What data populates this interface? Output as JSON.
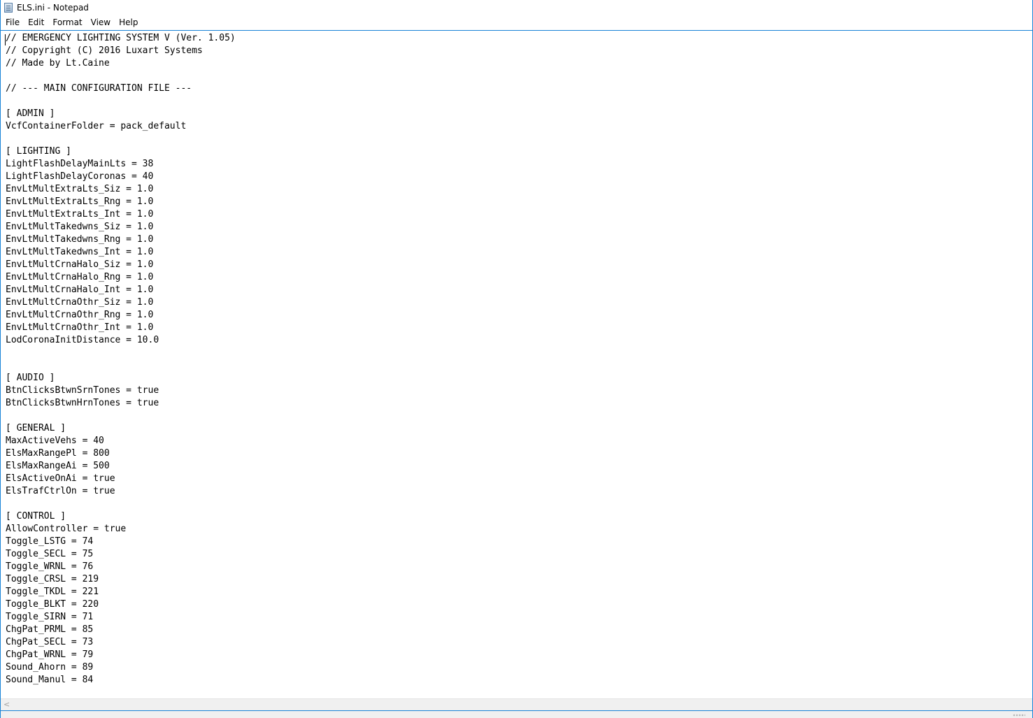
{
  "window": {
    "title": "ELS.ini - Notepad",
    "app_icon": "notepad-icon"
  },
  "menu": [
    {
      "label": "File"
    },
    {
      "label": "Edit"
    },
    {
      "label": "Format"
    },
    {
      "label": "View"
    },
    {
      "label": "Help"
    }
  ],
  "editor": {
    "lines": [
      "// EMERGENCY LIGHTING SYSTEM V (Ver. 1.05)",
      "// Copyright (C) 2016 Luxart Systems",
      "// Made by Lt.Caine",
      "",
      "// --- MAIN CONFIGURATION FILE ---",
      "",
      "[ ADMIN ]",
      "VcfContainerFolder = pack_default",
      "",
      "[ LIGHTING ]",
      "LightFlashDelayMainLts = 38",
      "LightFlashDelayCoronas = 40",
      "EnvLtMultExtraLts_Siz = 1.0",
      "EnvLtMultExtraLts_Rng = 1.0",
      "EnvLtMultExtraLts_Int = 1.0",
      "EnvLtMultTakedwns_Siz = 1.0",
      "EnvLtMultTakedwns_Rng = 1.0",
      "EnvLtMultTakedwns_Int = 1.0",
      "EnvLtMultCrnaHalo_Siz = 1.0",
      "EnvLtMultCrnaHalo_Rng = 1.0",
      "EnvLtMultCrnaHalo_Int = 1.0",
      "EnvLtMultCrnaOthr_Siz = 1.0",
      "EnvLtMultCrnaOthr_Rng = 1.0",
      "EnvLtMultCrnaOthr_Int = 1.0",
      "LodCoronaInitDistance = 10.0",
      "",
      "",
      "[ AUDIO ]",
      "BtnClicksBtwnSrnTones = true",
      "BtnClicksBtwnHrnTones = true",
      "",
      "[ GENERAL ]",
      "MaxActiveVehs = 40",
      "ElsMaxRangePl = 800",
      "ElsMaxRangeAi = 500",
      "ElsActiveOnAi = true",
      "ElsTrafCtrlOn = true",
      "",
      "[ CONTROL ]",
      "AllowController = true",
      "Toggle_LSTG = 74",
      "Toggle_SECL = 75",
      "Toggle_WRNL = 76",
      "Toggle_CRSL = 219",
      "Toggle_TKDL = 221",
      "Toggle_BLKT = 220",
      "Toggle_SIRN = 71",
      "ChgPat_PRML = 85",
      "ChgPat_SECL = 73",
      "ChgPat_WRNL = 79",
      "Sound_Ahorn = 89",
      "Sound_Manul = 84"
    ]
  },
  "scrollbar": {
    "left_arrow": "<"
  }
}
